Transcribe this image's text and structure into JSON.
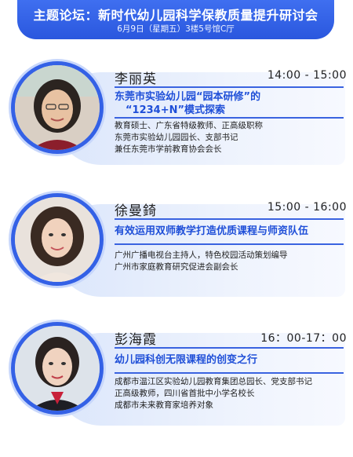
{
  "header": {
    "title": "主题论坛：新时代幼儿园科学保教质量提升研讨会",
    "subtitle": "6月9日（星期五）3楼5号馆C厅"
  },
  "speakers": [
    {
      "name": "李丽英",
      "time": "14:00 - 15:00",
      "topic_lines": [
        "东莞市实验幼儿园“园本研修”的",
        "“1234+N”模式探索"
      ],
      "bio": [
        "教育硕士、广东省特级教师、正高级职称",
        "东莞市实验幼儿园园长、支部书记",
        "兼任东莞市学前教育协会会长"
      ]
    },
    {
      "name": "徐曼錡",
      "time": "15:00 - 16:00",
      "topic_lines": [
        "有效运用双师教学打造优质课程与师资队伍"
      ],
      "bio": [
        "广州广播电视台主持人，特色校园活动策划编导",
        "广州市家庭教育研究促进会副会长"
      ]
    },
    {
      "name": "彭海霞",
      "time": "16：00-17：00",
      "topic_lines": [
        "幼儿园科创无限课程的创变之行"
      ],
      "bio": [
        "成都市温江区实验幼儿园教育集团总园长、党支部书记",
        "正高级教师，四川省首批中小学名校长",
        "成都市未来教育家培养对象"
      ]
    }
  ],
  "colors": {
    "accent": "#2a57de",
    "topic": "#1f4fd8",
    "card_bg": "#e6eefc"
  }
}
